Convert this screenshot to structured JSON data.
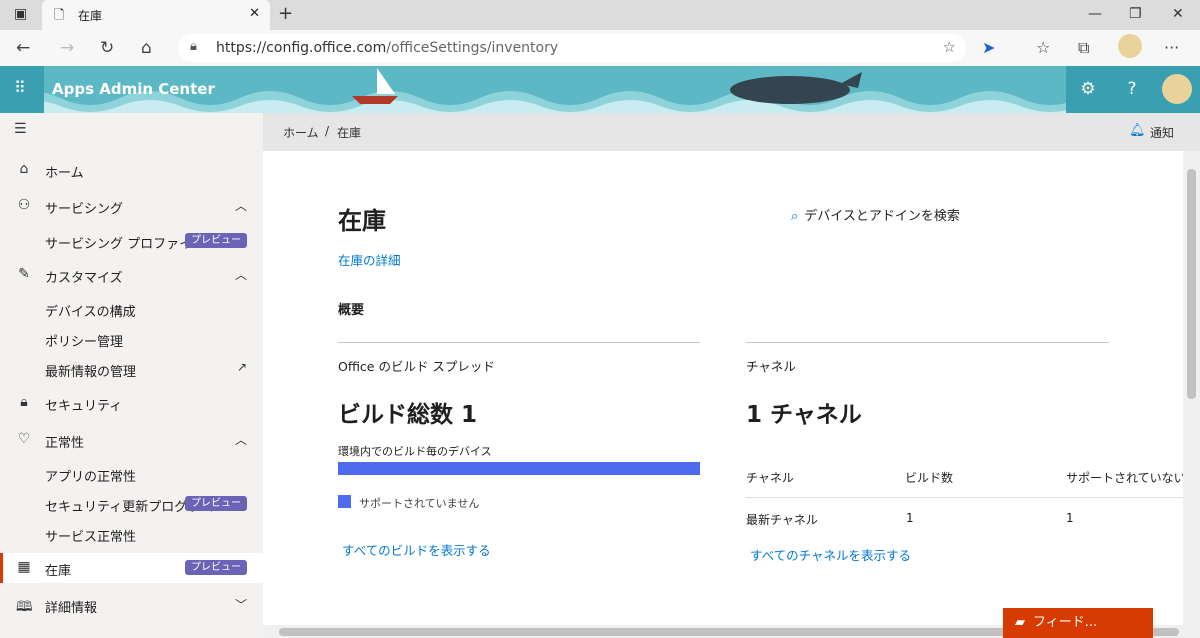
{
  "browser": {
    "tab_title": "在庫",
    "url_host": "https://config.office.com",
    "url_path": "/officeSettings/inventory"
  },
  "header": {
    "app_title": "Apps Admin Center",
    "colors": {
      "bar": "#5cb8c4",
      "button": "#3a9fb0"
    }
  },
  "sidebar": {
    "items": [
      {
        "label": "ホーム",
        "icon": "home-icon"
      },
      {
        "label": "サービシング",
        "icon": "person-settings-icon"
      },
      {
        "label": "サービシング プロファイル",
        "badge": "プレビュー"
      },
      {
        "label": "カスタマイズ",
        "icon": "edit-icon"
      },
      {
        "label": "デバイスの構成"
      },
      {
        "label": "ポリシー管理"
      },
      {
        "label": "最新情報の管理",
        "icon": "external-link-icon"
      },
      {
        "label": "セキュリティ",
        "icon": "lock-icon"
      },
      {
        "label": "正常性",
        "icon": "heart-pulse-icon"
      },
      {
        "label": "アプリの正常性"
      },
      {
        "label": "セキュリティ更新プログラム...",
        "badge": "プレビュー"
      },
      {
        "label": "サービス正常性"
      },
      {
        "label": "在庫",
        "icon": "table-icon",
        "badge": "プレビュー"
      },
      {
        "label": "詳細情報",
        "icon": "book-icon"
      }
    ]
  },
  "breadcrumb": {
    "home": "ホーム",
    "sep": "/",
    "current": "在庫"
  },
  "notify": "通知",
  "main": {
    "title": "在庫",
    "search": "デバイスとアドインを検索",
    "details_link": "在庫の詳細",
    "section": "概要",
    "build_card": {
      "heading": "Office のビルド スプレッド",
      "big": "ビルド総数 1",
      "caption": "環境内でのビルド毎のデバイス",
      "legend": "サポートされていません",
      "link": "すべてのビルドを表示する"
    },
    "channel_card": {
      "heading": "チャネル",
      "big": "1 チャネル",
      "columns": [
        "チャネル",
        "ビルド数",
        "サポートされていないビル"
      ],
      "row": [
        "最新チャネル",
        "1",
        "1"
      ],
      "link": "すべてのチャネルを表示する"
    }
  },
  "feedback": "フィード..."
}
